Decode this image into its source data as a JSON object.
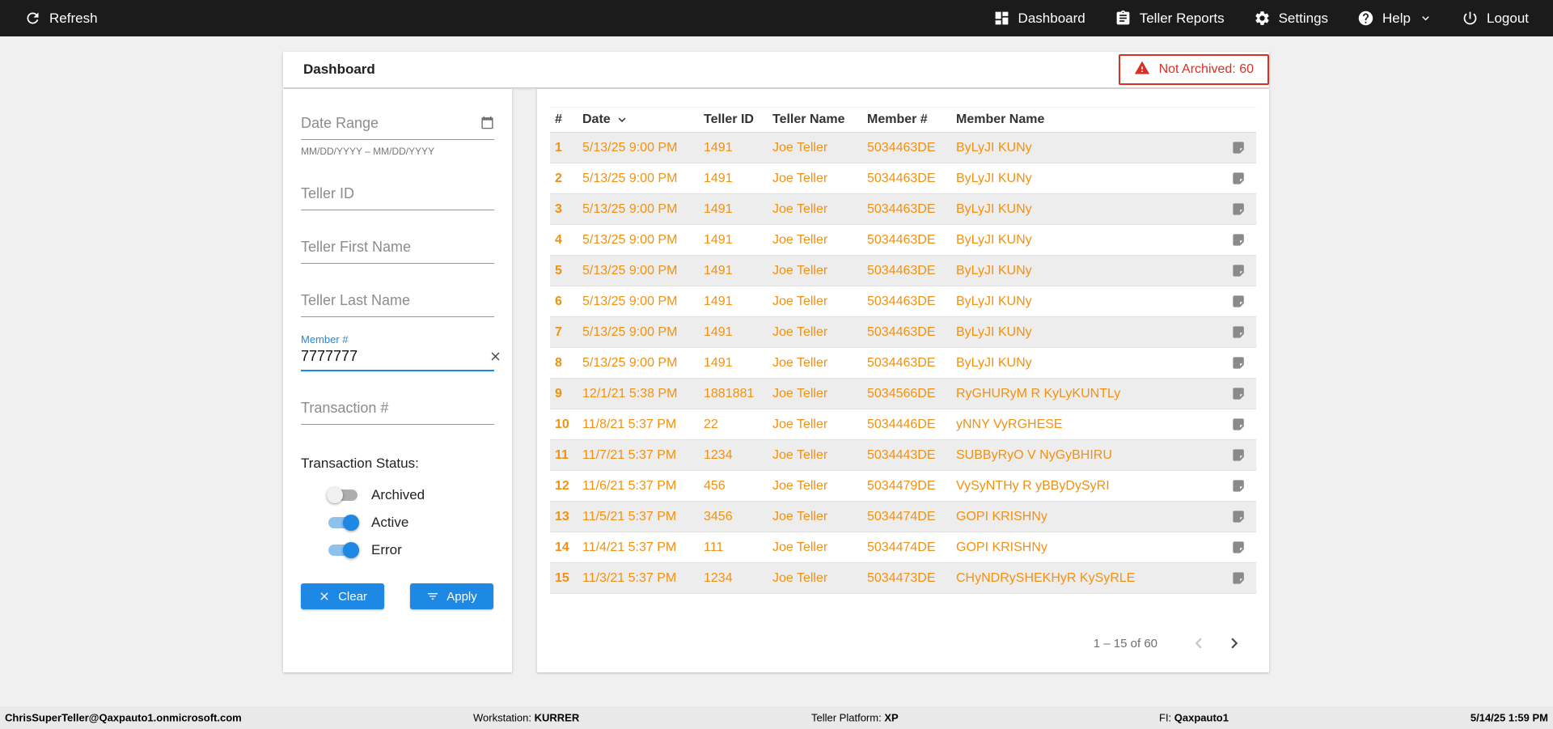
{
  "topbar": {
    "refresh_label": "Refresh",
    "nav": [
      {
        "label": "Dashboard"
      },
      {
        "label": "Teller Reports"
      },
      {
        "label": "Settings"
      },
      {
        "label": "Help"
      },
      {
        "label": "Logout"
      }
    ]
  },
  "header": {
    "title": "Dashboard",
    "alert_badge": "Not Archived: 60"
  },
  "filters": {
    "date_range": {
      "placeholder": "Date Range",
      "helper": "MM/DD/YYYY – MM/DD/YYYY"
    },
    "teller_id_placeholder": "Teller ID",
    "teller_first_name_placeholder": "Teller First Name",
    "teller_last_name_placeholder": "Teller Last Name",
    "member": {
      "label": "Member #",
      "value": "7777777"
    },
    "transaction_placeholder": "Transaction #",
    "status": {
      "label": "Transaction Status:",
      "toggles": [
        {
          "label": "Archived",
          "on": false
        },
        {
          "label": "Active",
          "on": true
        },
        {
          "label": "Error",
          "on": true
        }
      ]
    },
    "clear_label": "Clear",
    "apply_label": "Apply"
  },
  "table": {
    "columns": [
      "#",
      "Date",
      "Teller ID",
      "Teller Name",
      "Member #",
      "Member Name"
    ],
    "rows": [
      {
        "n": "1",
        "date": "5/13/25 9:00 PM",
        "teller_id": "1491",
        "teller_name": "Joe Teller",
        "member_no": "5034463DE",
        "member_name": "ByLyJI KUNy"
      },
      {
        "n": "2",
        "date": "5/13/25 9:00 PM",
        "teller_id": "1491",
        "teller_name": "Joe Teller",
        "member_no": "5034463DE",
        "member_name": "ByLyJI KUNy"
      },
      {
        "n": "3",
        "date": "5/13/25 9:00 PM",
        "teller_id": "1491",
        "teller_name": "Joe Teller",
        "member_no": "5034463DE",
        "member_name": "ByLyJI KUNy"
      },
      {
        "n": "4",
        "date": "5/13/25 9:00 PM",
        "teller_id": "1491",
        "teller_name": "Joe Teller",
        "member_no": "5034463DE",
        "member_name": "ByLyJI KUNy"
      },
      {
        "n": "5",
        "date": "5/13/25 9:00 PM",
        "teller_id": "1491",
        "teller_name": "Joe Teller",
        "member_no": "5034463DE",
        "member_name": "ByLyJI KUNy"
      },
      {
        "n": "6",
        "date": "5/13/25 9:00 PM",
        "teller_id": "1491",
        "teller_name": "Joe Teller",
        "member_no": "5034463DE",
        "member_name": "ByLyJI KUNy"
      },
      {
        "n": "7",
        "date": "5/13/25 9:00 PM",
        "teller_id": "1491",
        "teller_name": "Joe Teller",
        "member_no": "5034463DE",
        "member_name": "ByLyJI KUNy"
      },
      {
        "n": "8",
        "date": "5/13/25 9:00 PM",
        "teller_id": "1491",
        "teller_name": "Joe Teller",
        "member_no": "5034463DE",
        "member_name": "ByLyJI KUNy"
      },
      {
        "n": "9",
        "date": "12/1/21 5:38 PM",
        "teller_id": "1881881",
        "teller_name": "Joe Teller",
        "member_no": "5034566DE",
        "member_name": "RyGHURyM R KyLyKUNTLy"
      },
      {
        "n": "10",
        "date": "11/8/21 5:37 PM",
        "teller_id": "22",
        "teller_name": "Joe Teller",
        "member_no": "5034446DE",
        "member_name": "yNNY VyRGHESE"
      },
      {
        "n": "11",
        "date": "11/7/21 5:37 PM",
        "teller_id": "1234",
        "teller_name": "Joe Teller",
        "member_no": "5034443DE",
        "member_name": "SUBByRyO V NyGyBHIRU"
      },
      {
        "n": "12",
        "date": "11/6/21 5:37 PM",
        "teller_id": "456",
        "teller_name": "Joe Teller",
        "member_no": "5034479DE",
        "member_name": "VySyNTHy R yBByDySyRI"
      },
      {
        "n": "13",
        "date": "11/5/21 5:37 PM",
        "teller_id": "3456",
        "teller_name": "Joe Teller",
        "member_no": "5034474DE",
        "member_name": "GOPI KRISHNy"
      },
      {
        "n": "14",
        "date": "11/4/21 5:37 PM",
        "teller_id": "111",
        "teller_name": "Joe Teller",
        "member_no": "5034474DE",
        "member_name": "GOPI KRISHNy"
      },
      {
        "n": "15",
        "date": "11/3/21 5:37 PM",
        "teller_id": "1234",
        "teller_name": "Joe Teller",
        "member_no": "5034473DE",
        "member_name": "CHyNDRySHEKHyR KySyRLE"
      }
    ],
    "pagination": "1 – 15 of 60"
  },
  "statusbar": {
    "user": "ChrisSuperTeller@Qaxpauto1.onmicrosoft.com",
    "workstation_label": "Workstation: ",
    "workstation_value": "KURRER",
    "platform_label": "Teller Platform: ",
    "platform_value": "XP",
    "fi_label": "FI: ",
    "fi_value": "Qaxpauto1",
    "datetime": "5/14/25 1:59 PM"
  },
  "colors": {
    "accent_blue": "#1E88E5",
    "data_orange": "#F29111",
    "alert_red": "#D93025",
    "topbar_black": "#1B1B1B"
  }
}
